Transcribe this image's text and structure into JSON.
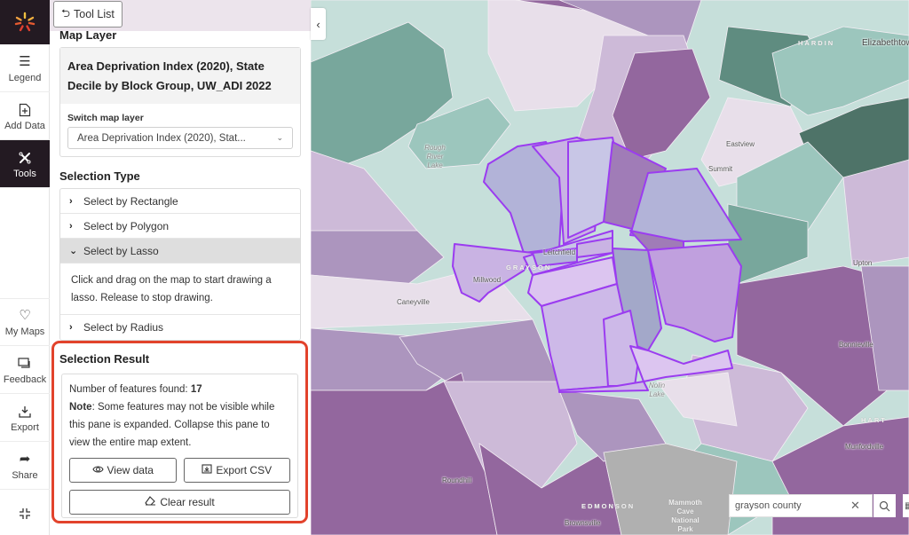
{
  "rail": {
    "items": [
      {
        "label": "Legend",
        "icon": "list-icon"
      },
      {
        "label": "Add Data",
        "icon": "add-file-icon"
      },
      {
        "label": "Tools",
        "icon": "tools-icon",
        "active": true
      }
    ],
    "bottom_items": [
      {
        "label": "My Maps",
        "icon": "heart-icon"
      },
      {
        "label": "Feedback",
        "icon": "chat-icon"
      },
      {
        "label": "Export",
        "icon": "download-icon"
      },
      {
        "label": "Share",
        "icon": "share-icon"
      }
    ]
  },
  "panel": {
    "tool_list_label": "Tool List",
    "map_layer_heading": "Map Layer",
    "layer_title": "Area Deprivation Index (2020), State Decile by Block Group, UW_ADI 2022",
    "switch_label": "Switch map layer",
    "switch_value": "Area Deprivation Index (2020), Stat...",
    "selection_type_heading": "Selection Type",
    "selection_types": [
      {
        "label": "Select by Rectangle",
        "open": false
      },
      {
        "label": "Select by Polygon",
        "open": false
      },
      {
        "label": "Select by Lasso",
        "open": true
      },
      {
        "label": "Select by Radius",
        "open": false
      }
    ],
    "lasso_description": "Click and drag on the map to start drawing a lasso. Release to stop drawing.",
    "result": {
      "heading": "Selection Result",
      "features_label": "Number of features found: ",
      "features_count": "17",
      "note_label": "Note",
      "note_text": ": Some features may not be visible while this pane is expanded. Collapse this pane to view the entire map extent.",
      "view_data": "View data",
      "export_csv": "Export CSV",
      "clear_result": "Clear result"
    }
  },
  "map": {
    "labels": {
      "hardin": "HARDIN",
      "elizabethtown": "Elizabethtown",
      "eastview": "Eastview",
      "summit": "Summit",
      "leitchfield": "Leitchfield",
      "grayson": "GRAYSON",
      "millwood": "Millwood",
      "caneyville": "Caneyville",
      "upton": "Upton",
      "bonnieville": "Bonnieville",
      "hart": "HART",
      "munfordville": "Munfordville",
      "roundhill": "Roundhill",
      "edmonson": "EDMONSON",
      "brownsville": "Brownsville",
      "mammoth_cave": "Mammoth Cave National Park",
      "rough_river_lake": "Rough River Lake",
      "nolin_lake": "Nolin Lake"
    },
    "search_value": "grayson county",
    "selection_outline_color": "#9b3cf0",
    "highlight_color": "#e2432c"
  }
}
